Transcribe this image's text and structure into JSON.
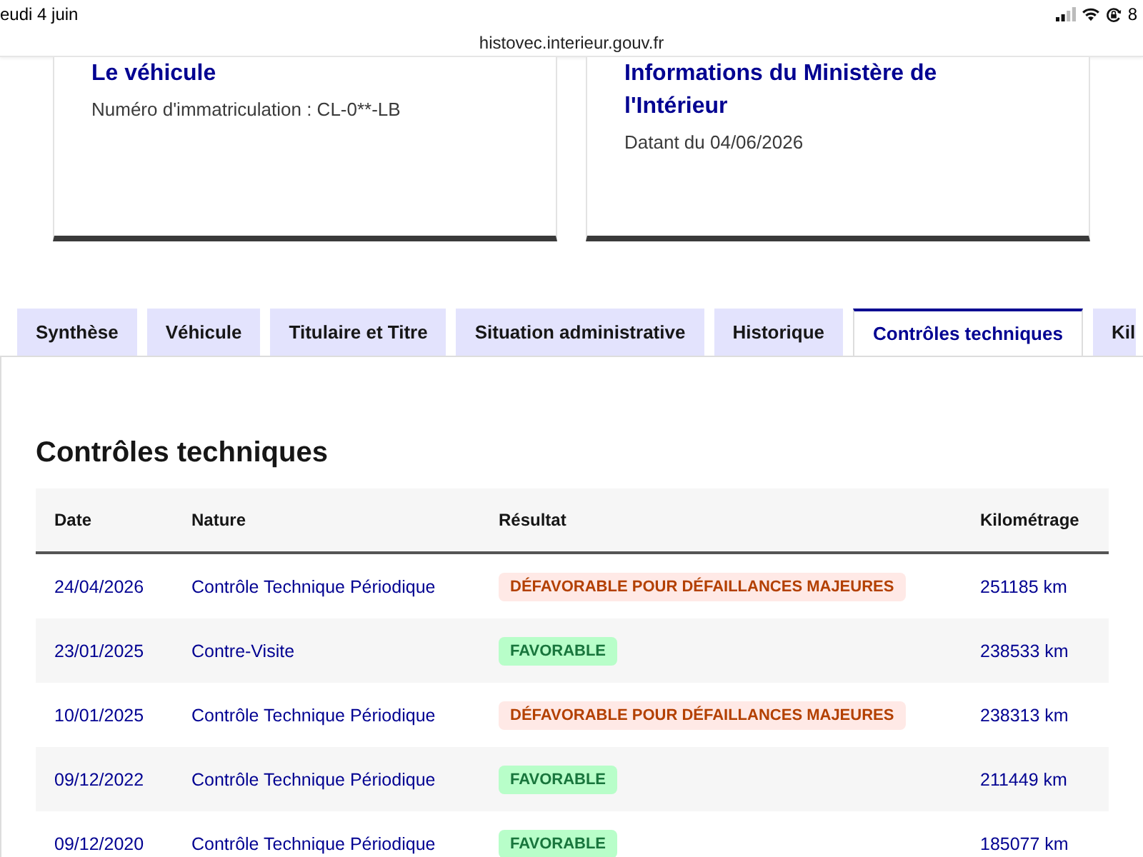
{
  "status_bar": {
    "date": "eudi 4 juin",
    "battery": "8"
  },
  "address_bar": {
    "url": "histovec.interieur.gouv.fr"
  },
  "cards": [
    {
      "title": "Le véhicule",
      "text": "Numéro d'immatriculation : CL-0**-LB"
    },
    {
      "title": "Informations du Ministère de l'Intérieur",
      "text": "Datant du 04/06/2026"
    }
  ],
  "tabs": [
    {
      "label": "Synthèse",
      "selected": false
    },
    {
      "label": "Véhicule",
      "selected": false
    },
    {
      "label": "Titulaire et Titre",
      "selected": false
    },
    {
      "label": "Situation administrative",
      "selected": false
    },
    {
      "label": "Historique",
      "selected": false
    },
    {
      "label": "Contrôles techniques",
      "selected": true
    },
    {
      "label": "Kil",
      "selected": false
    }
  ],
  "panel": {
    "heading": "Contrôles techniques",
    "table": {
      "columns": [
        "Date",
        "Nature",
        "Résultat",
        "Kilométrage"
      ],
      "rows": [
        {
          "date": "24/04/2026",
          "nature": "Contrôle Technique Périodique",
          "result": {
            "label": "DÉFAVORABLE POUR DÉFAILLANCES MAJEURES",
            "kind": "error"
          },
          "mileage": "251185 km"
        },
        {
          "date": "23/01/2025",
          "nature": "Contre-Visite",
          "result": {
            "label": "FAVORABLE",
            "kind": "success"
          },
          "mileage": "238533 km"
        },
        {
          "date": "10/01/2025",
          "nature": "Contrôle Technique Périodique",
          "result": {
            "label": "DÉFAVORABLE POUR DÉFAILLANCES MAJEURES",
            "kind": "error"
          },
          "mileage": "238313 km"
        },
        {
          "date": "09/12/2022",
          "nature": "Contrôle Technique Périodique",
          "result": {
            "label": "FAVORABLE",
            "kind": "success"
          },
          "mileage": "211449 km"
        },
        {
          "date": "09/12/2020",
          "nature": "Contrôle Technique Périodique",
          "result": {
            "label": "FAVORABLE",
            "kind": "success"
          },
          "mileage": "185077 km"
        }
      ]
    }
  }
}
